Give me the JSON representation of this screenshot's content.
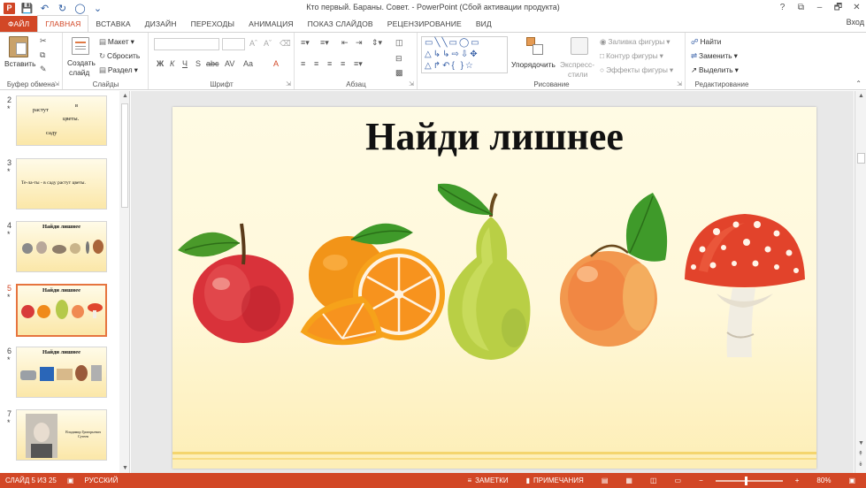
{
  "window": {
    "title": "Кто первый. Бараны. Совет. - PowerPoint (Сбой активации продукта)",
    "controls": [
      "?",
      "⧉",
      "–",
      "🗗",
      "✕"
    ],
    "sign_in": "Вход"
  },
  "quick_access": [
    "save-icon",
    "undo-icon",
    "redo-icon",
    "start-from-beginning-icon",
    "customize-icon"
  ],
  "tabs": [
    {
      "label": "ФАЙЛ"
    },
    {
      "label": "ГЛАВНАЯ"
    },
    {
      "label": "ВСТАВКА"
    },
    {
      "label": "ДИЗАЙН"
    },
    {
      "label": "ПЕРЕХОДЫ"
    },
    {
      "label": "АНИМАЦИЯ"
    },
    {
      "label": "ПОКАЗ СЛАЙДОВ"
    },
    {
      "label": "РЕЦЕНЗИРОВАНИЕ"
    },
    {
      "label": "ВИД"
    }
  ],
  "ribbon": {
    "clipboard": {
      "label": "Буфер обмена",
      "paste": "Вставить"
    },
    "slides": {
      "label": "Слайды",
      "new_slide_1": "Создать",
      "new_slide_2": "слайд",
      "layout": "Макет",
      "reset": "Сбросить",
      "section": "Раздел"
    },
    "font": {
      "label": "Шрифт",
      "buttons": [
        "Ж",
        "К",
        "Ч",
        "S",
        "abc",
        "AV",
        "Aa",
        "A"
      ]
    },
    "paragraph": {
      "label": "Абзац"
    },
    "drawing": {
      "label": "Рисование",
      "arrange": "Упорядочить",
      "quick_styles_1": "Экспресс-",
      "quick_styles_2": "стили",
      "fill": "Заливка фигуры",
      "outline": "Контур фигуры",
      "effects": "Эффекты фигуры"
    },
    "editing": {
      "label": "Редактирование",
      "find": "Найти",
      "replace": "Заменить",
      "select": "Выделить"
    }
  },
  "thumbnails": [
    {
      "number": "2",
      "star": "*",
      "words": [
        "растут",
        "в",
        "цветы.",
        "саду"
      ]
    },
    {
      "number": "3",
      "star": "*",
      "text": "Те-ла-ты -   в саду растут цветы."
    },
    {
      "number": "4",
      "star": "*",
      "title": "Найди лишнее"
    },
    {
      "number": "5",
      "star": "*",
      "title": "Найди лишнее",
      "selected": true
    },
    {
      "number": "6",
      "star": "*",
      "title": "Найди лишнее"
    },
    {
      "number": "7",
      "star": "*",
      "caption": "Владимир Григорьевич Сутеев"
    }
  ],
  "slide": {
    "title": "Найди лишнее",
    "items": [
      "apple",
      "orange",
      "pear",
      "peach",
      "fly-agaric-mushroom"
    ]
  },
  "status": {
    "slide_info": "СЛАЙД 5 ИЗ 25",
    "language": "РУССКИЙ",
    "notes": "ЗАМЕТКИ",
    "comments": "ПРИМЕЧАНИЯ",
    "zoom": "80%",
    "zoom_fraction": 0.45
  },
  "colors": {
    "accent": "#d24726",
    "slide_background": "#fff8da"
  }
}
